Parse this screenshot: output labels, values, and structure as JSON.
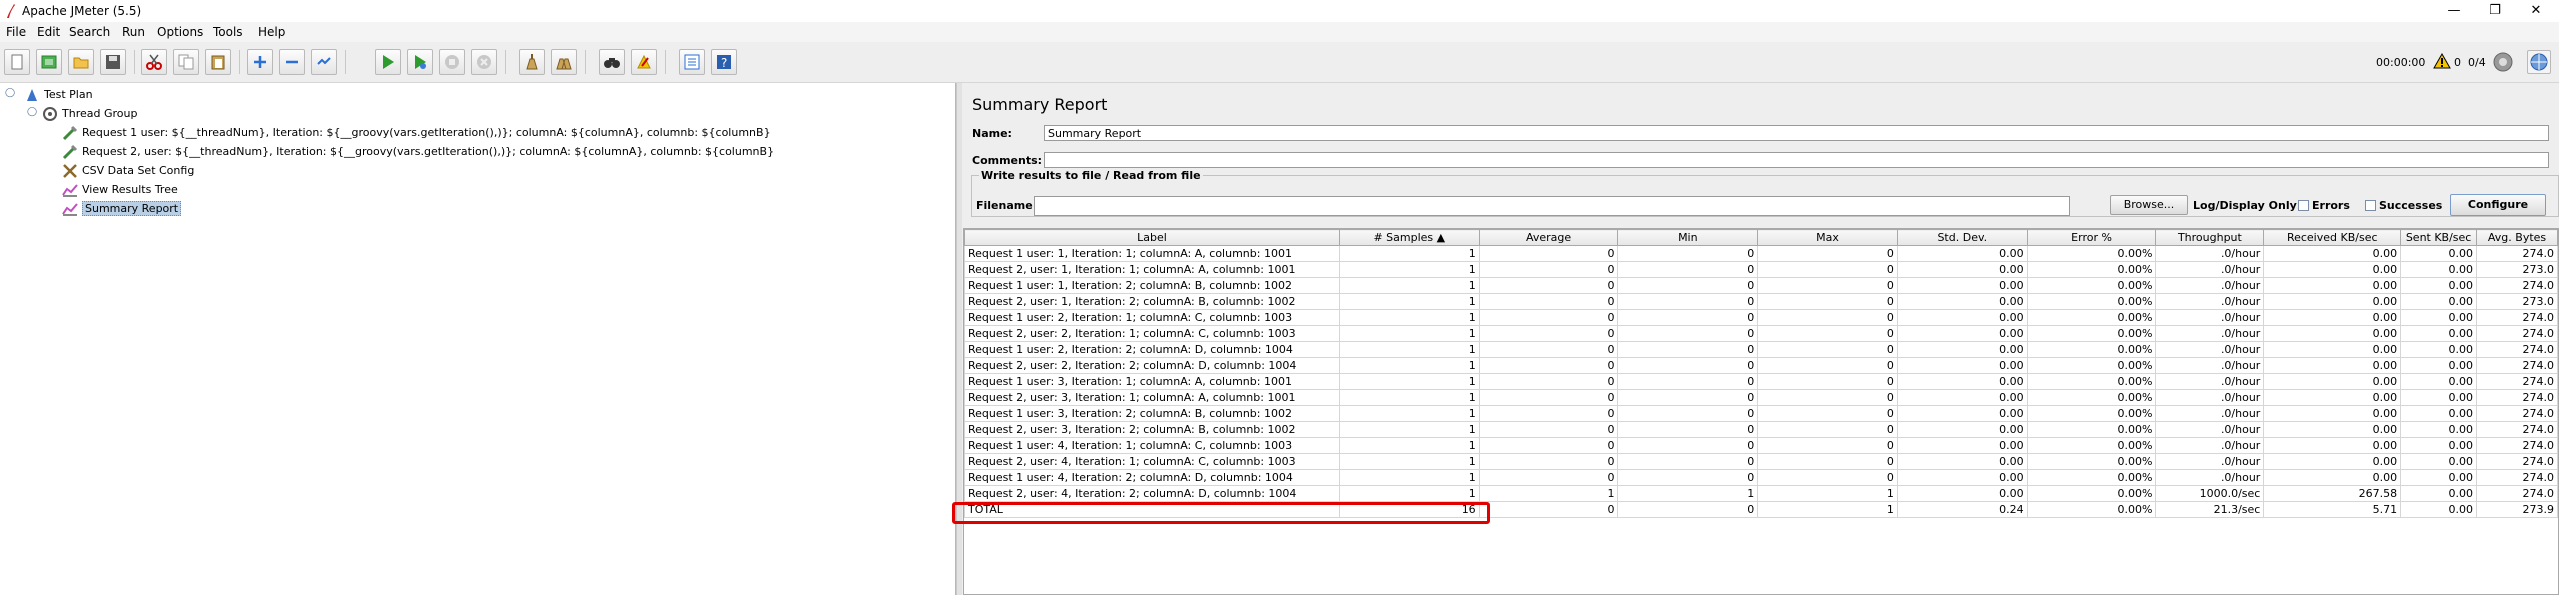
{
  "window": {
    "title": "Apache JMeter (5.5)",
    "controls": {
      "minimize": "—",
      "restore": "❐",
      "close": "✕"
    }
  },
  "menu": [
    "File",
    "Edit",
    "Search",
    "Run",
    "Options",
    "Tools",
    "Help"
  ],
  "toolbar": {
    "icons": [
      "new-icon",
      "templates-icon",
      "open-icon",
      "save-icon",
      "cut-icon",
      "copy-icon",
      "paste-icon",
      "expand-icon",
      "collapse-icon",
      "toggle-icon",
      "start-icon",
      "start-no-pause-icon",
      "stop-icon",
      "shutdown-icon",
      "clear-icon",
      "clear-all-icon",
      "search-icon",
      "reset-search-icon",
      "function-helper-icon",
      "help-icon"
    ],
    "timer": "00:00:00",
    "warnings": "0",
    "threads": "0/4"
  },
  "tree": [
    {
      "label": "Test Plan",
      "icon": "test-plan-icon"
    },
    {
      "label": "Thread Group",
      "icon": "thread-group-icon"
    },
    {
      "label": "Request 1 user: ${__threadNum}, Iteration: ${__groovy(vars.getIteration(),)}; columnA: ${columnA}, columnb: ${columnB}",
      "icon": "sampler-icon"
    },
    {
      "label": "Request 2, user: ${__threadNum}, Iteration: ${__groovy(vars.getIteration(),)}; columnA: ${columnA}, columnb: ${columnB}",
      "icon": "sampler-icon"
    },
    {
      "label": "CSV Data Set Config",
      "icon": "config-icon"
    },
    {
      "label": "View Results Tree",
      "icon": "listener-icon"
    },
    {
      "label": "Summary Report",
      "icon": "listener-icon"
    }
  ],
  "panel": {
    "title": "Summary Report",
    "name_label": "Name:",
    "name_value": "Summary Report",
    "comments_label": "Comments:",
    "comments_value": "",
    "fileset_legend": "Write results to file / Read from file",
    "filename_label": "Filename",
    "filename_value": "",
    "browse_label": "Browse...",
    "log_display_label": "Log/Display Only:",
    "errors_label": "Errors",
    "successes_label": "Successes",
    "configure_label": "Configure"
  },
  "table": {
    "columns": [
      "Label",
      "# Samples ▲",
      "Average",
      "Min",
      "Max",
      "Std. Dev.",
      "Error %",
      "Throughput",
      "Received KB/sec",
      "Sent KB/sec",
      "Avg. Bytes"
    ],
    "rows": [
      [
        "Request 1 user: 1, Iteration: 1; columnA: A, columnb: 1001",
        "1",
        "0",
        "0",
        "0",
        "0.00",
        "0.00%",
        ".0/hour",
        "0.00",
        "0.00",
        "274.0"
      ],
      [
        "Request 2, user: 1, Iteration: 1; columnA: A, columnb: 1001",
        "1",
        "0",
        "0",
        "0",
        "0.00",
        "0.00%",
        ".0/hour",
        "0.00",
        "0.00",
        "273.0"
      ],
      [
        "Request 1 user: 1, Iteration: 2; columnA: B, columnb: 1002",
        "1",
        "0",
        "0",
        "0",
        "0.00",
        "0.00%",
        ".0/hour",
        "0.00",
        "0.00",
        "274.0"
      ],
      [
        "Request 2, user: 1, Iteration: 2; columnA: B, columnb: 1002",
        "1",
        "0",
        "0",
        "0",
        "0.00",
        "0.00%",
        ".0/hour",
        "0.00",
        "0.00",
        "273.0"
      ],
      [
        "Request 1 user: 2, Iteration: 1; columnA: C, columnb: 1003",
        "1",
        "0",
        "0",
        "0",
        "0.00",
        "0.00%",
        ".0/hour",
        "0.00",
        "0.00",
        "274.0"
      ],
      [
        "Request 2, user: 2, Iteration: 1; columnA: C, columnb: 1003",
        "1",
        "0",
        "0",
        "0",
        "0.00",
        "0.00%",
        ".0/hour",
        "0.00",
        "0.00",
        "274.0"
      ],
      [
        "Request 1 user: 2, Iteration: 2; columnA: D, columnb: 1004",
        "1",
        "0",
        "0",
        "0",
        "0.00",
        "0.00%",
        ".0/hour",
        "0.00",
        "0.00",
        "274.0"
      ],
      [
        "Request 2, user: 2, Iteration: 2; columnA: D, columnb: 1004",
        "1",
        "0",
        "0",
        "0",
        "0.00",
        "0.00%",
        ".0/hour",
        "0.00",
        "0.00",
        "274.0"
      ],
      [
        "Request 1 user: 3, Iteration: 1; columnA: A, columnb: 1001",
        "1",
        "0",
        "0",
        "0",
        "0.00",
        "0.00%",
        ".0/hour",
        "0.00",
        "0.00",
        "274.0"
      ],
      [
        "Request 2, user: 3, Iteration: 1; columnA: A, columnb: 1001",
        "1",
        "0",
        "0",
        "0",
        "0.00",
        "0.00%",
        ".0/hour",
        "0.00",
        "0.00",
        "274.0"
      ],
      [
        "Request 1 user: 3, Iteration: 2; columnA: B, columnb: 1002",
        "1",
        "0",
        "0",
        "0",
        "0.00",
        "0.00%",
        ".0/hour",
        "0.00",
        "0.00",
        "274.0"
      ],
      [
        "Request 2, user: 3, Iteration: 2; columnA: B, columnb: 1002",
        "1",
        "0",
        "0",
        "0",
        "0.00",
        "0.00%",
        ".0/hour",
        "0.00",
        "0.00",
        "274.0"
      ],
      [
        "Request 1 user: 4, Iteration: 1; columnA: C, columnb: 1003",
        "1",
        "0",
        "0",
        "0",
        "0.00",
        "0.00%",
        ".0/hour",
        "0.00",
        "0.00",
        "274.0"
      ],
      [
        "Request 2, user: 4, Iteration: 1; columnA: C, columnb: 1003",
        "1",
        "0",
        "0",
        "0",
        "0.00",
        "0.00%",
        ".0/hour",
        "0.00",
        "0.00",
        "274.0"
      ],
      [
        "Request 1 user: 4, Iteration: 2; columnA: D, columnb: 1004",
        "1",
        "0",
        "0",
        "0",
        "0.00",
        "0.00%",
        ".0/hour",
        "0.00",
        "0.00",
        "274.0"
      ],
      [
        "Request 2, user: 4, Iteration: 2; columnA: D, columnb: 1004",
        "1",
        "1",
        "1",
        "1",
        "0.00",
        "0.00%",
        "1000.0/sec",
        "267.58",
        "0.00",
        "274.0"
      ]
    ],
    "total": [
      "TOTAL",
      "16",
      "0",
      "0",
      "1",
      "0.24",
      "0.00%",
      "21.3/sec",
      "5.71",
      "0.00",
      "273.9"
    ]
  },
  "colors": {
    "highlight_box": "#e00000",
    "selection": "#b8cfe5",
    "warning": "#f5c400"
  }
}
